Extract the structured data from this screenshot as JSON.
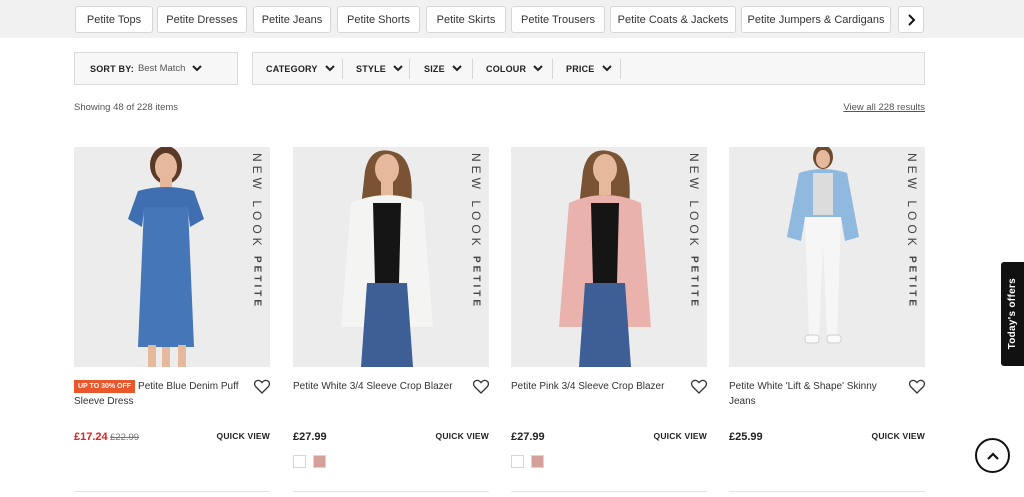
{
  "category_chips": [
    {
      "label": "Petite Tops"
    },
    {
      "label": "Petite Dresses"
    },
    {
      "label": "Petite Jeans"
    },
    {
      "label": "Petite Shorts"
    },
    {
      "label": "Petite Skirts"
    },
    {
      "label": "Petite Trousers"
    },
    {
      "label": "Petite Coats & Jackets"
    },
    {
      "label": "Petite Jumpers & Cardigans"
    }
  ],
  "sort": {
    "label": "SORT BY:",
    "value": "Best Match"
  },
  "filters": [
    {
      "label": "CATEGORY"
    },
    {
      "label": "STYLE"
    },
    {
      "label": "SIZE"
    },
    {
      "label": "COLOUR"
    },
    {
      "label": "PRICE"
    }
  ],
  "results": {
    "showing": "Showing 48 of 228 items",
    "view_all": "View all 228 results"
  },
  "brand": {
    "top": "NEW LOOK",
    "bottom": "PETITE"
  },
  "quick_view_label": "QUICK VIEW",
  "products": [
    {
      "badge": "UP TO 30% OFF",
      "title": "Petite Blue Denim Puff Sleeve Dress",
      "price": "£17.24",
      "old_price": "£22.99"
    },
    {
      "title": "Petite White 3/4 Sleeve Crop Blazer",
      "price": "£27.99"
    },
    {
      "title": "Petite Pink 3/4 Sleeve Crop Blazer",
      "price": "£27.99"
    },
    {
      "title": "Petite White 'Lift & Shape' Skinny Jeans",
      "price": "£25.99"
    }
  ],
  "side_tab": {
    "label": "Today's offers"
  },
  "colors": {
    "sale_price": "#e02020",
    "offer_badge": "#e9572b",
    "swatch_white": "#ffffff",
    "swatch_pink": "#d4a099"
  },
  "icons": [
    "chevron-right-icon",
    "chevron-down-icon",
    "heart-icon",
    "chevron-up-icon"
  ]
}
